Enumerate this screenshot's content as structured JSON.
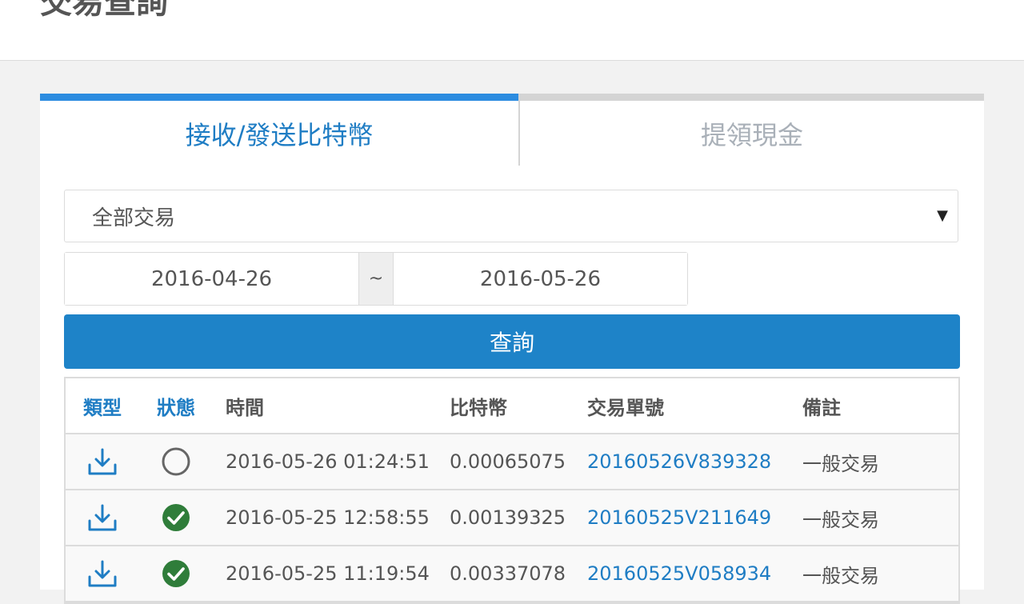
{
  "page": {
    "title": "交易查詢"
  },
  "tabs": [
    {
      "label": "接收/發送比特幣",
      "active": true
    },
    {
      "label": "提領現金",
      "active": false
    }
  ],
  "filter": {
    "selected": "全部交易",
    "date_from": "2016-04-26",
    "separator": "~",
    "date_to": "2016-05-26",
    "query_label": "查詢"
  },
  "table": {
    "columns": {
      "type": "類型",
      "status": "狀態",
      "time": "時間",
      "btc": "比特幣",
      "tx_id": "交易單號",
      "note": "備註"
    },
    "rows": [
      {
        "type_icon": "download-icon",
        "status_icon": "pending-circle-icon",
        "time": "2016-05-26 01:24:51",
        "btc": "0.00065075",
        "tx_id": "20160526V839328",
        "note": "一般交易"
      },
      {
        "type_icon": "download-icon",
        "status_icon": "check-circle-icon",
        "time": "2016-05-25 12:58:55",
        "btc": "0.00139325",
        "tx_id": "20160525V211649",
        "note": "一般交易"
      },
      {
        "type_icon": "download-icon",
        "status_icon": "check-circle-icon",
        "time": "2016-05-25 11:19:54",
        "btc": "0.00337078",
        "tx_id": "20160525V058934",
        "note": "一般交易"
      }
    ]
  },
  "colors": {
    "accent": "#1e83c8",
    "link": "#1f7dc4",
    "success": "#2f7d3a",
    "pending": "#666666"
  }
}
